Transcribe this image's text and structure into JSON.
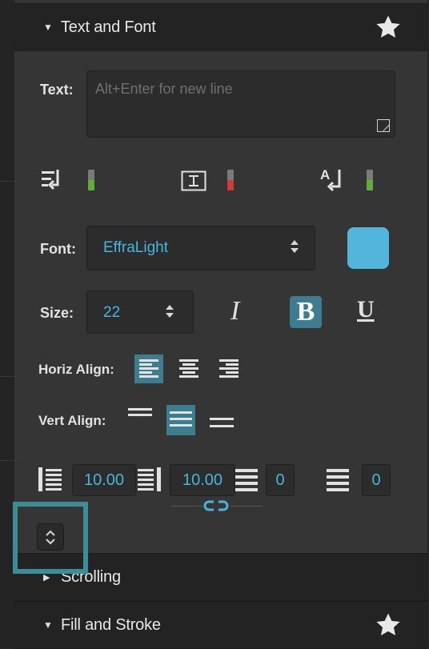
{
  "sections": {
    "text_and_font": {
      "title": "Text and Font",
      "expanded": true
    },
    "scrolling": {
      "title": "Scrolling",
      "expanded": false
    },
    "fill_and_stroke": {
      "title": "Fill and Stroke",
      "expanded": true
    }
  },
  "text": {
    "label": "Text:",
    "placeholder": "Alt+Enter for new line",
    "value": ""
  },
  "toggles": {
    "wrap": {
      "icon": "wrap-text-icon",
      "state_color": "#5fae3a"
    },
    "clip": {
      "icon": "text-box-icon",
      "state_color": "#d43a3a"
    },
    "auto_fit": {
      "icon": "auto-fit-icon",
      "state_color": "#5fae3a"
    }
  },
  "font": {
    "label": "Font:",
    "value": "EffraLight",
    "color": "#52b6dc"
  },
  "size": {
    "label": "Size:",
    "value": "22"
  },
  "style": {
    "italic": "I",
    "bold": "B",
    "underline": "U",
    "bold_active": true
  },
  "horiz_align": {
    "label": "Horiz Align:",
    "options": [
      "left",
      "center",
      "right"
    ],
    "selected": "left"
  },
  "vert_align": {
    "label": "Vert Align:",
    "options": [
      "top",
      "middle",
      "bottom"
    ],
    "selected": "middle"
  },
  "spacing": {
    "line_spacing": "10.00",
    "char_spacing": "10.00",
    "spacing_3": "0",
    "spacing_4": "0"
  },
  "accent_color": "#3d7d8f"
}
